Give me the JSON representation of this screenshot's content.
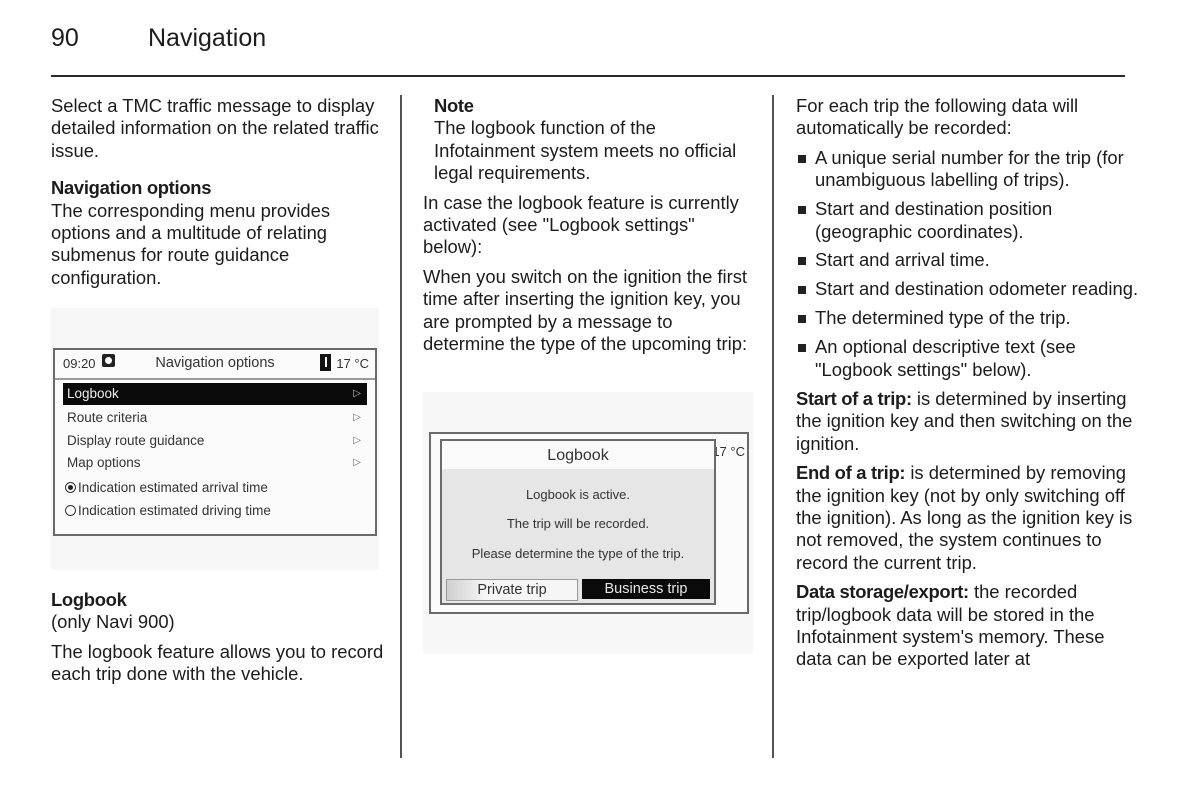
{
  "header": {
    "page_number": "90",
    "section_title": "Navigation"
  },
  "column1": {
    "intro": "Select a TMC traffic message to display detailed information on the related traffic issue.",
    "nav_options_heading": "Navigation options",
    "nav_options_text": "The corresponding menu provides options and a multitude of relating submenus for route guidance configuration.",
    "screen": {
      "time": "09:20",
      "title": "Navigation options",
      "temperature": "17 °C",
      "menu_items": [
        {
          "label": "Logbook",
          "selected": true
        },
        {
          "label": "Route criteria"
        },
        {
          "label": "Display route guidance"
        },
        {
          "label": "Map options"
        }
      ],
      "radio_options": [
        {
          "label": "Indication estimated arrival time",
          "checked": true
        },
        {
          "label": "Indication estimated driving time",
          "checked": false
        }
      ]
    },
    "logbook_heading": "Logbook",
    "logbook_sub": "(only Navi 900)",
    "logbook_text": "The logbook feature allows you to record each trip done with the vehicle."
  },
  "column2": {
    "note_heading": "Note",
    "note_text": "The logbook function of the Infotainment system meets no official legal requirements.",
    "para1": "In case the logbook feature is currently activated (see \"Logbook settings\" below):",
    "para2": "When you switch on the ignition the first time after inserting the ignition key, you are prompted by a message to determine the type of the upcoming trip:",
    "screen": {
      "background_temperature": "17 °C",
      "dialog_title": "Logbook",
      "line1": "Logbook is active.",
      "line2": "The trip will be recorded.",
      "line3": "Please determine the type of the trip.",
      "button_private": "Private trip",
      "button_business": "Business trip"
    }
  },
  "column3": {
    "intro": "For each trip the following data will automatically be recorded:",
    "bullets": [
      "A unique serial number for the trip (for unambiguous labelling of trips).",
      "Start and destination position (geographic coordinates).",
      "Start and arrival time.",
      "Start and destination odometer reading.",
      "The determined type of the trip.",
      "An optional descriptive text (see \"Logbook settings\" below)."
    ],
    "start_label": "Start of a trip:",
    "start_text": " is determined by inserting the ignition key and then switching on the ignition.",
    "end_label": "End of a trip:",
    "end_text": " is determined by removing the ignition key (not by only switching off the ignition). As long as the ignition key is not removed, the system continues to record the current trip.",
    "storage_label": "Data storage/export:",
    "storage_text": " the recorded trip/logbook data will be stored in the Infotainment system's memory. These data can be exported later at"
  }
}
